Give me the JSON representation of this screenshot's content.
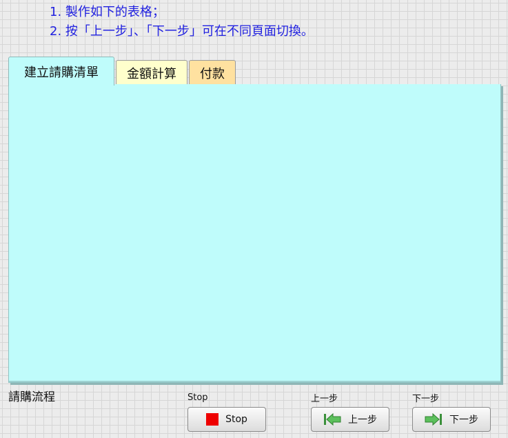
{
  "instructions": {
    "line1": "1. 製作如下的表格；",
    "line2": "2. 按「上一步」、「下一步」可在不同頁面切換。"
  },
  "tabs": [
    {
      "label": "建立請購清單",
      "color": "#bffcfb",
      "selected": true
    },
    {
      "label": "金額計算",
      "color": "#ffffcc",
      "selected": false
    },
    {
      "label": "付款",
      "color": "#ffe1a0",
      "selected": false
    }
  ],
  "tab_control_label": "請購流程",
  "buttons": {
    "stop": {
      "caption": "Stop",
      "label": "Stop",
      "icon": "stop-square-icon",
      "color": "#ee0000"
    },
    "prev": {
      "caption": "上一步",
      "label": "上一步",
      "icon": "arrow-left-icon",
      "color": "#4caf50"
    },
    "next": {
      "caption": "下一步",
      "label": "下一步",
      "icon": "arrow-right-icon",
      "color": "#4caf50"
    }
  }
}
